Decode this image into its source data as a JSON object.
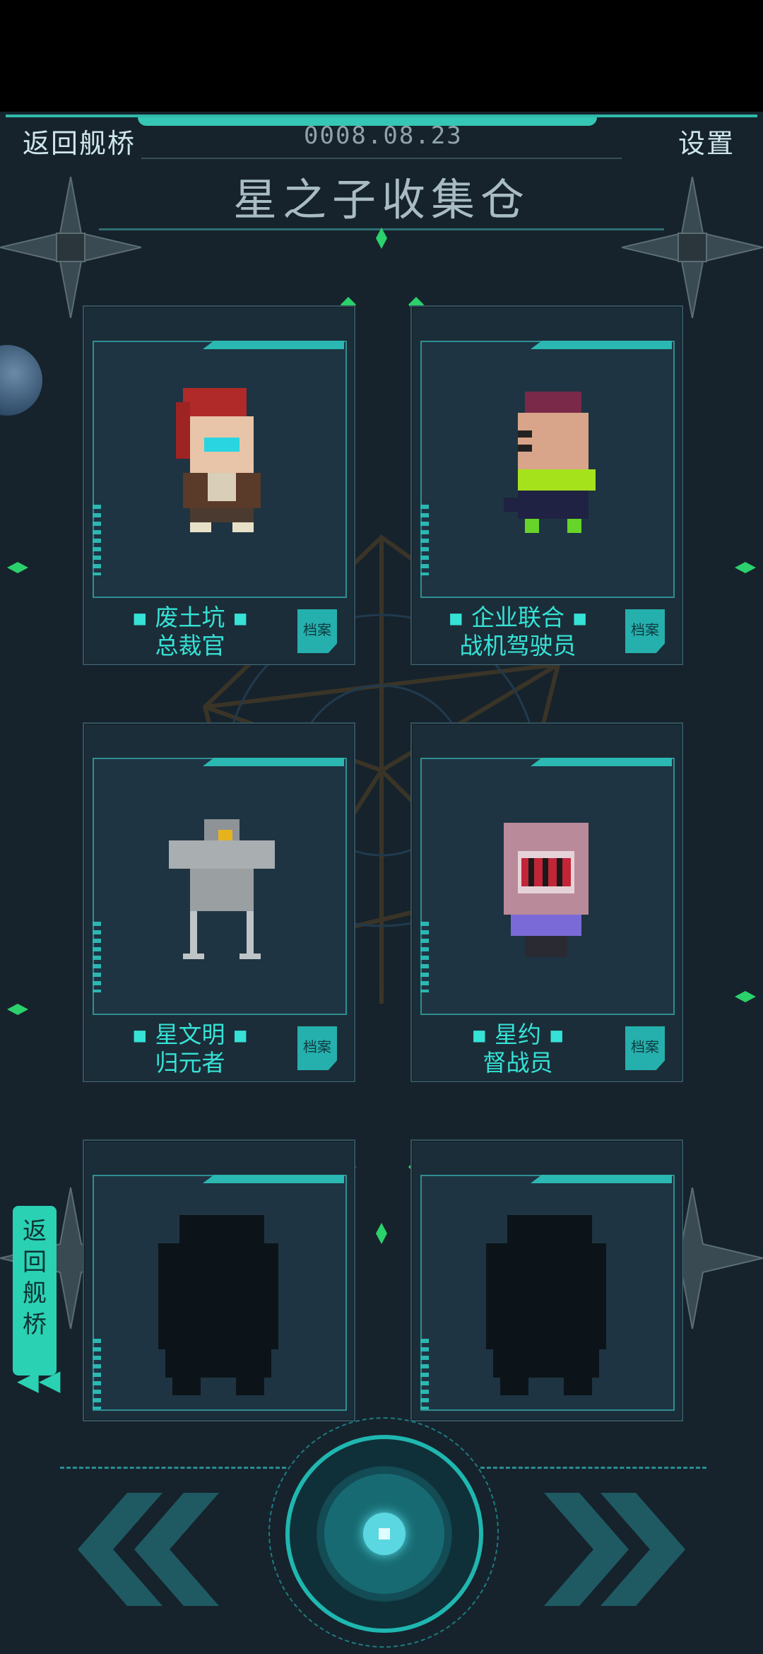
{
  "header": {
    "back_label": "返回舰桥",
    "date": "0008.08.23",
    "settings_label": "设置"
  },
  "title": "星之子收集仓",
  "cards": [
    {
      "name_line1": "▪ 废土坑 ▪",
      "name_line2": "总裁官",
      "file_label": "档案",
      "locked": false
    },
    {
      "name_line1": "▪ 企业联合 ▪",
      "name_line2": "战机驾驶员",
      "file_label": "档案",
      "locked": false
    },
    {
      "name_line1": "▪ 星文明 ▪",
      "name_line2": "归元者",
      "file_label": "档案",
      "locked": false
    },
    {
      "name_line1": "▪ 星约 ▪",
      "name_line2": "督战员",
      "file_label": "档案",
      "locked": false
    },
    {
      "name_line1": "",
      "name_line2": "",
      "file_label": "",
      "locked": true
    },
    {
      "name_line1": "",
      "name_line2": "",
      "file_label": "",
      "locked": true
    }
  ],
  "side_back_label": "返回舰桥",
  "side_back_icon": "double-chevron-left-icon",
  "bottom_controls": {
    "prev_icon": "double-chevron-left-icon",
    "center_icon": "action-core-icon",
    "next_icon": "double-chevron-right-icon"
  },
  "colors": {
    "accent": "#36e2d6",
    "background": "#16232c",
    "gem": "#2bd16b"
  }
}
